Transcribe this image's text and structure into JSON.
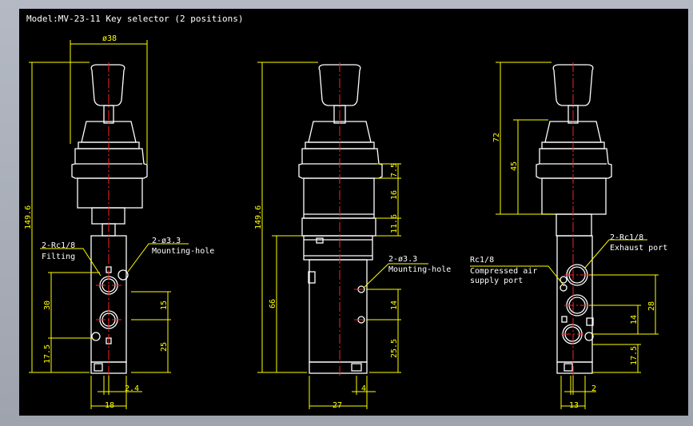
{
  "title": "Model:MV-23-11 Key selector (2 positions)",
  "colors": {
    "outline": "#ffffff",
    "dimension": "#ffff00",
    "centerline": "#ff2020",
    "background": "#000000"
  },
  "views": {
    "left": {
      "dims": {
        "top_width": "ø38",
        "height": "149.6",
        "d30": "30",
        "d17_5": "17.5",
        "d15": "15",
        "d25": "25",
        "d2_4": "2.4",
        "width18": "18"
      },
      "labels": {
        "port_line1": "2-Rc1/8",
        "port_line2": "Filting",
        "hole_line1": "2-ø3.3",
        "hole_line2": "Mounting-hole"
      }
    },
    "center": {
      "dims": {
        "height": "149.6",
        "d7_5": "7.5",
        "d16": "16",
        "d11_6": "11.6",
        "d66": "66",
        "d14": "14",
        "d25_5": "25.5",
        "d4": "4",
        "width27": "27"
      },
      "labels": {
        "hole_line1": "2-ø3.3",
        "hole_line2": "Mounting-hole"
      }
    },
    "right": {
      "dims": {
        "d72": "72",
        "d45": "45",
        "d28": "28",
        "d14": "14",
        "d17_5": "17.5",
        "d2": "2",
        "width13": "13"
      },
      "labels": {
        "exhaust_line1": "2-Rc1/8",
        "exhaust_line2": "Exhaust port",
        "supply_line1": "Rc1/8",
        "supply_line2": "Compressed air",
        "supply_line3": "supply port"
      }
    }
  }
}
